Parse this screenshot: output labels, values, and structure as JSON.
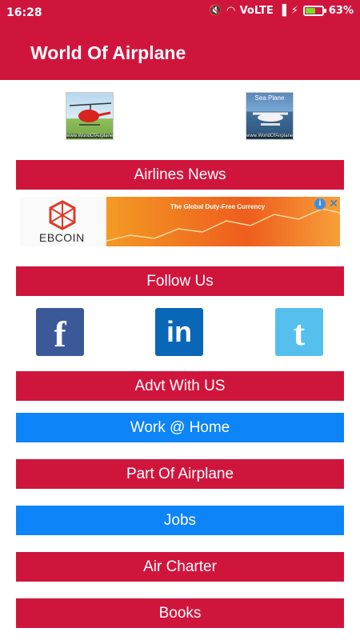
{
  "status_bar": {
    "time": "16:28",
    "network": "VoLTE",
    "battery_percent": "63%",
    "battery_level": 0.63
  },
  "app_bar": {
    "title": "World Of Airplane"
  },
  "thumbnails": {
    "helicopter": {
      "caption": "www.WorldOfAirplane.com"
    },
    "sea_plane": {
      "title": "Sea Plane",
      "caption": "www.WorldOfAirplane.com"
    }
  },
  "menu": {
    "airlines_news": "Airlines News",
    "follow_us": "Follow Us",
    "advt_with_us": "Advt With US",
    "work_at_home": "Work @ Home",
    "part_of_airplane": "Part Of Airplane",
    "jobs": "Jobs",
    "air_charter": "Air Charter",
    "books": "Books"
  },
  "ad": {
    "brand": "EBCOIN",
    "tagline": "The Global Duty-Free Currency",
    "info_glyph": "i",
    "close_glyph": "✕"
  },
  "social": {
    "facebook": "f",
    "linkedin": "in",
    "twitter": "t"
  },
  "colors": {
    "primary_red": "#d0153d",
    "accent_blue": "#0d84f7"
  }
}
